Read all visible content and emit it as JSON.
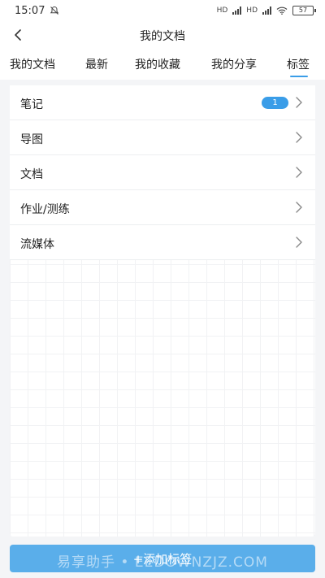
{
  "status_bar": {
    "time": "15:07",
    "network_1": "HD",
    "network_2": "HD",
    "battery": "57"
  },
  "header": {
    "title": "我的文档",
    "back_icon": "chevron-left-icon"
  },
  "tabs": [
    {
      "label": "我的文档",
      "active": false
    },
    {
      "label": "最新",
      "active": false
    },
    {
      "label": "我的收藏",
      "active": false
    },
    {
      "label": "我的分享",
      "active": false
    },
    {
      "label": "标签",
      "active": true
    }
  ],
  "tags": [
    {
      "label": "笔记",
      "badge": "1"
    },
    {
      "label": "导图"
    },
    {
      "label": "文档"
    },
    {
      "label": "作业/测练"
    },
    {
      "label": "流媒体"
    }
  ],
  "add_button": {
    "label": "+添加标签"
  },
  "watermark": "易享助手 • EEDOWNZJZ.COM",
  "colors": {
    "accent": "#3a9de8",
    "button": "#5aaeea"
  }
}
